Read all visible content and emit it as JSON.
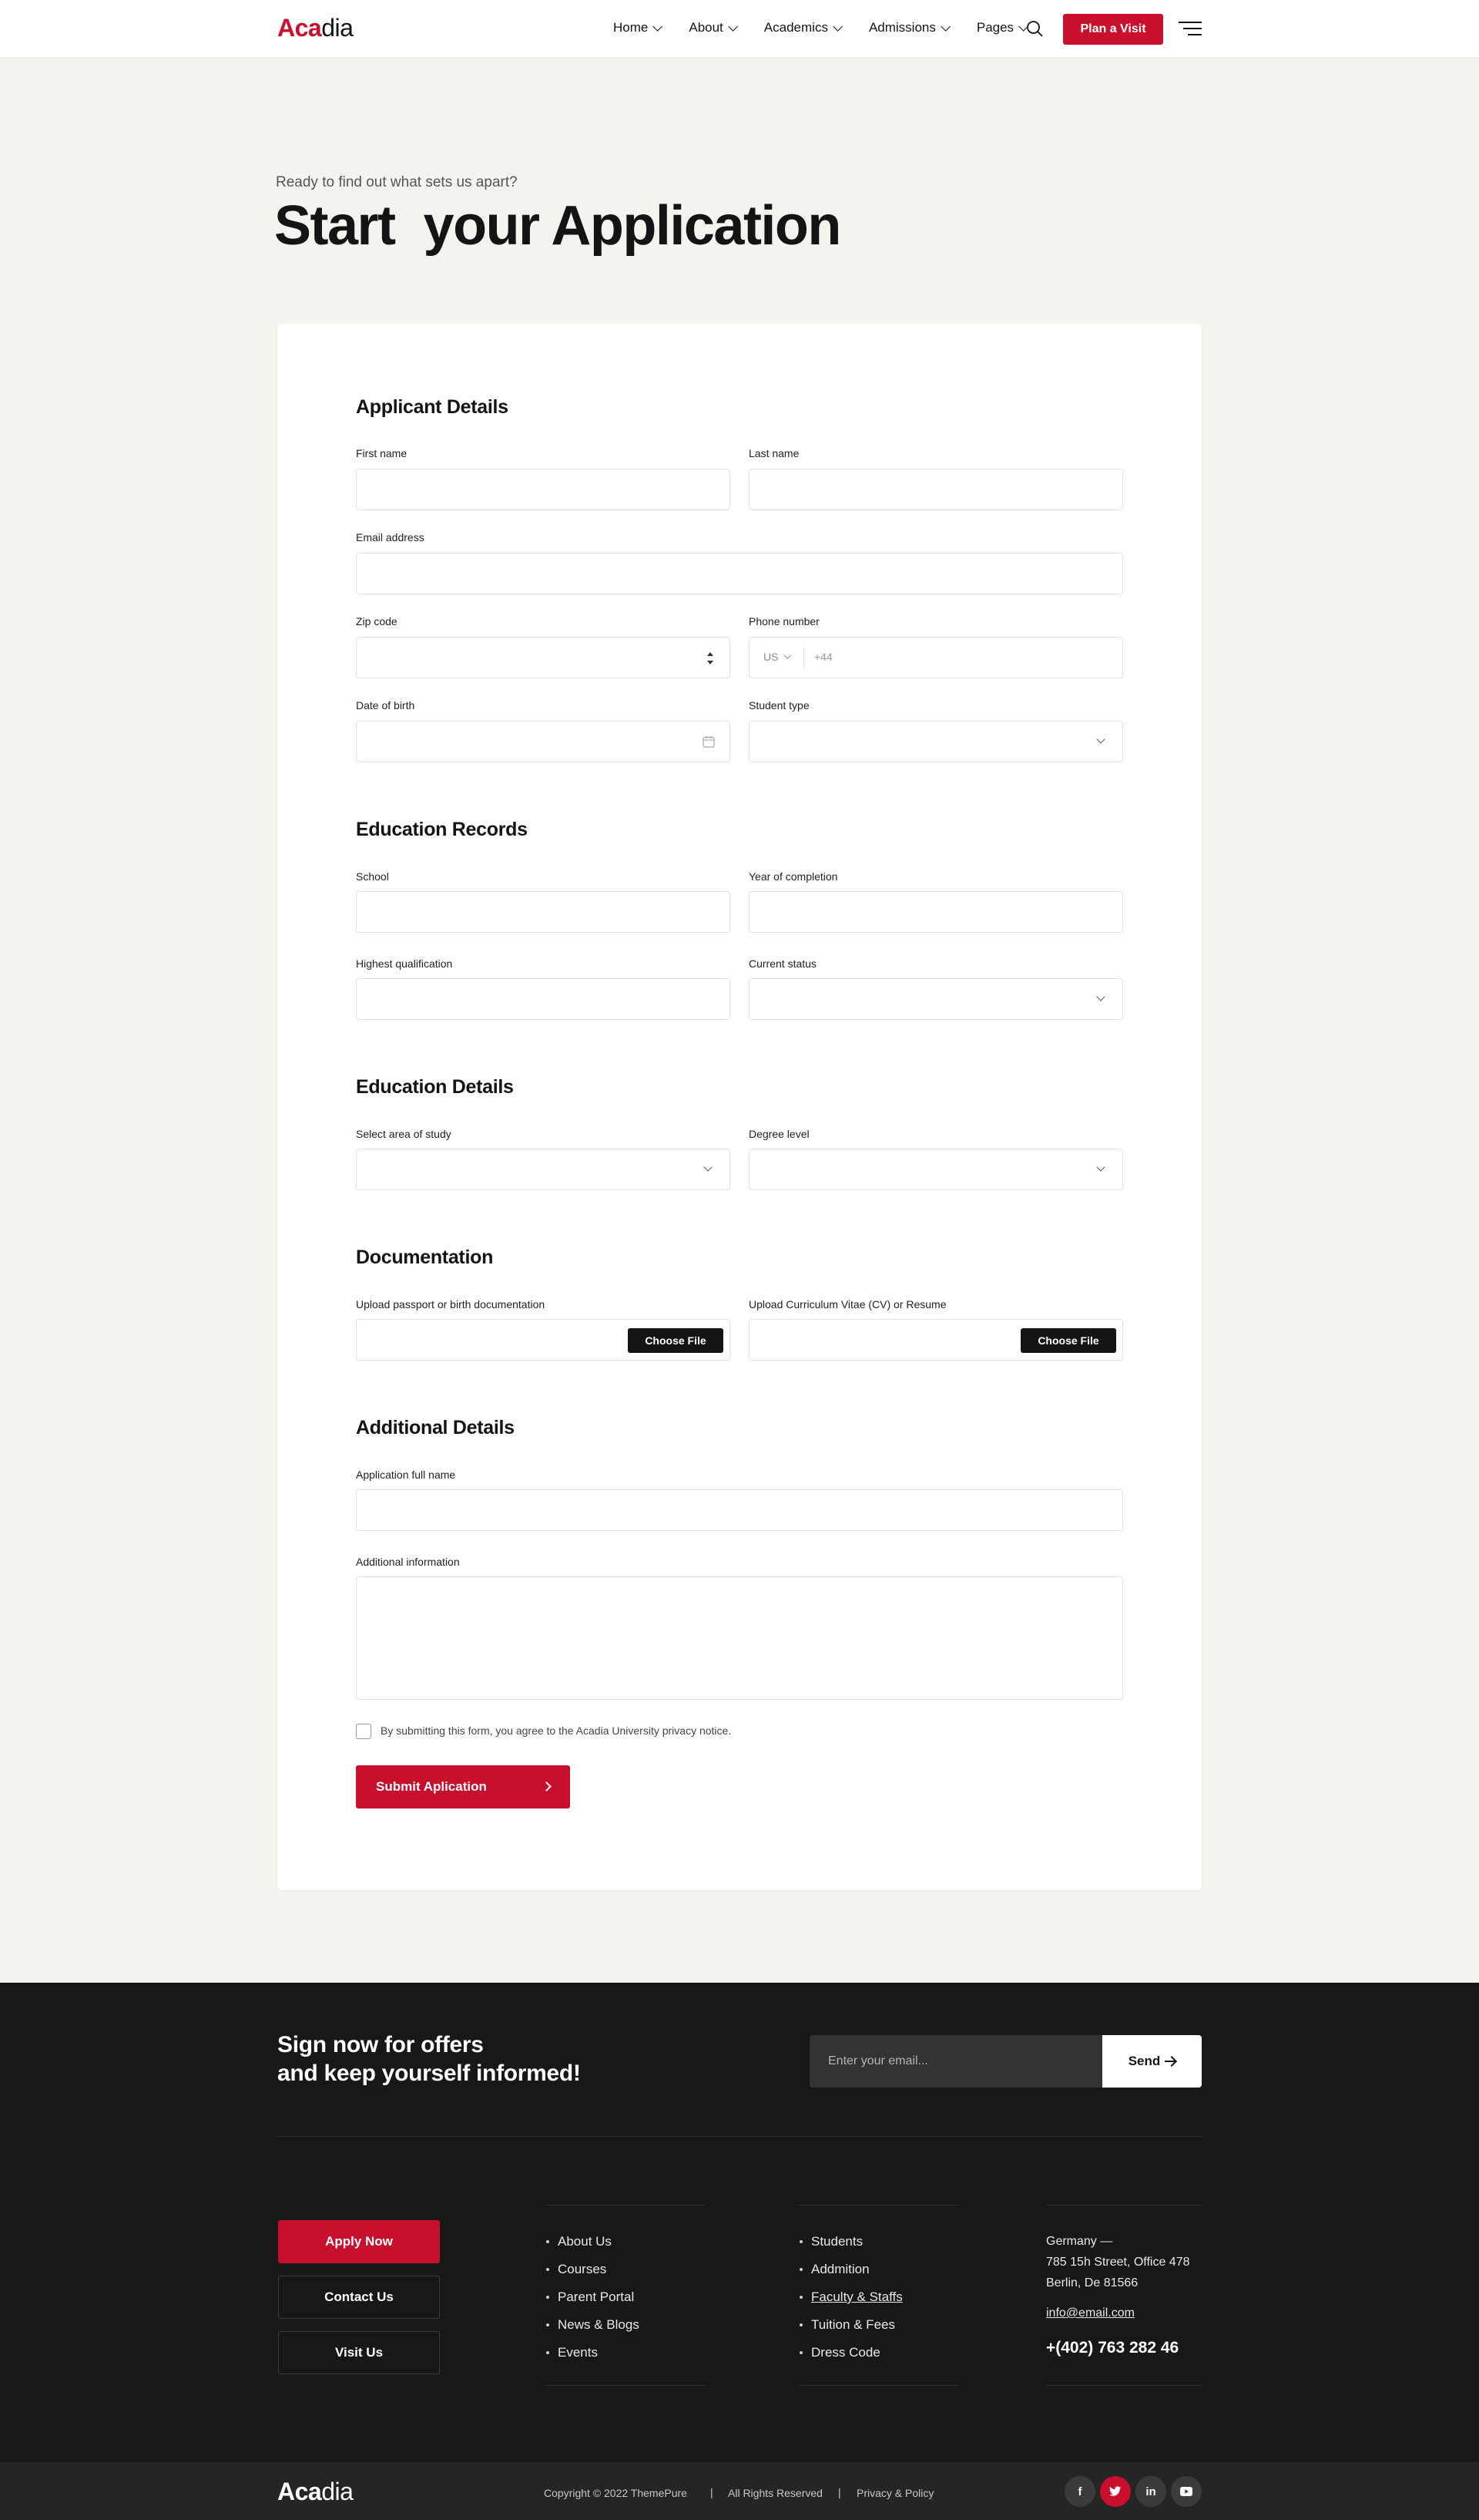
{
  "header": {
    "logo_part1": "Aca",
    "logo_part2": "dia",
    "nav": [
      "Home",
      "About",
      "Academics",
      "Admissions",
      "Pages"
    ],
    "plan_label": "Plan a Visit"
  },
  "hero": {
    "eyebrow": "Ready to find out what sets us apart?",
    "title": "Start  your Application"
  },
  "form": {
    "applicant": {
      "title": "Applicant Details",
      "first_name": "First name",
      "last_name": "Last name",
      "email": "Email address",
      "zip": "Zip code",
      "phone": "Phone number",
      "phone_country": "US",
      "phone_placeholder": "+44",
      "dob": "Date of birth",
      "student_type": "Student type"
    },
    "records": {
      "title": "Education Records",
      "school": "School",
      "year": "Year of completion",
      "qualification": "Highest qualification",
      "status": "Current status"
    },
    "details": {
      "title": "Education Details",
      "area": "Select area of study",
      "degree": "Degree level"
    },
    "docs": {
      "title": "Documentation",
      "passport": "Upload passport or birth documentation",
      "cv": "Upload Curriculum Vitae (CV) or Resume",
      "choose": "Choose File"
    },
    "additional": {
      "title": "Additional Details",
      "full_name": "Application full name",
      "info": "Additional information"
    },
    "consent": "By submitting this form, you agree to the Acadia University privacy notice.",
    "submit": "Submit Aplication"
  },
  "footer": {
    "news_line1": "Sign now for offers",
    "news_line2": "and keep yourself informed!",
    "email_placeholder": "Enter your email...",
    "send": "Send",
    "buttons": [
      "Apply Now",
      "Contact Us",
      "Visit Us"
    ],
    "links1": [
      "About Us",
      "Courses",
      "Parent Portal",
      "News & Blogs",
      "Events"
    ],
    "links2": [
      "Students",
      "Addmition",
      "Faculty & Staffs",
      "Tuition & Fees",
      "Dress Code"
    ],
    "address_country": "Germany —",
    "address_line1": "785 15h Street, Office 478",
    "address_line2": "Berlin, De 81566",
    "email": "info@email.com",
    "phone": "+(402) 763 282 46"
  },
  "bottom": {
    "logo_part1": "Aca",
    "logo_part2": "dia",
    "copyright": "Copyright © 2022 ThemePure",
    "rights": "All Rights Reserved",
    "privacy": "Privacy & Policy",
    "social": [
      "f",
      "t",
      "in",
      "yt"
    ]
  },
  "colors": {
    "brand": "#c8102e",
    "dark": "#181818",
    "page_bg": "#f4f3ee"
  }
}
